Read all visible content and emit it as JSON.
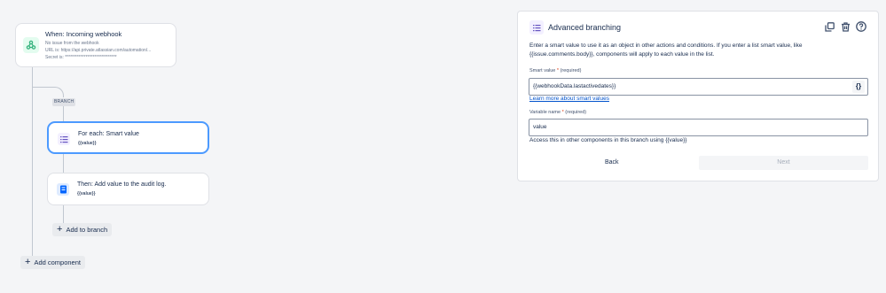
{
  "trigger": {
    "title": "When: Incoming webhook",
    "line1": "No issue from the webhook",
    "line2": "URL is: https://api.private.atlassian.com/automation/...",
    "line3": "Secret is: ******************************",
    "icon": "webhook-icon"
  },
  "branch": {
    "badge": "BRANCH",
    "for_each": {
      "title": "For each: Smart value",
      "sub": "{{value}}",
      "icon": "list-icon"
    },
    "audit": {
      "title": "Then: Add value to the audit log.",
      "sub": "{{value}}",
      "icon": "audit-log-icon"
    },
    "add_to_branch": "Add to branch"
  },
  "add_component": "Add component",
  "panel": {
    "title": "Advanced branching",
    "icon": "list-icon",
    "tools": [
      "copy-icon",
      "trash-icon",
      "help-icon"
    ],
    "description": "Enter a smart value to use it as an object in other actions and conditions. If you enter a list smart value, like {{issue.comments.body}}, components will apply to each value in the list.",
    "smart_value_label": "Smart value",
    "required_mark": "*",
    "required_text": "(required)",
    "smart_value": "{{webhookData.lastactivedates}}",
    "brace_button": "{}",
    "learn_more": "Learn more about smart values",
    "variable_label": "Variable name",
    "variable_value": "value",
    "hint": "Access this in other components in this branch using {{value}}",
    "back": "Back",
    "next": "Next"
  },
  "colors": {
    "accent": "#4c9aff",
    "link": "#0052cc",
    "required": "#de350b"
  }
}
